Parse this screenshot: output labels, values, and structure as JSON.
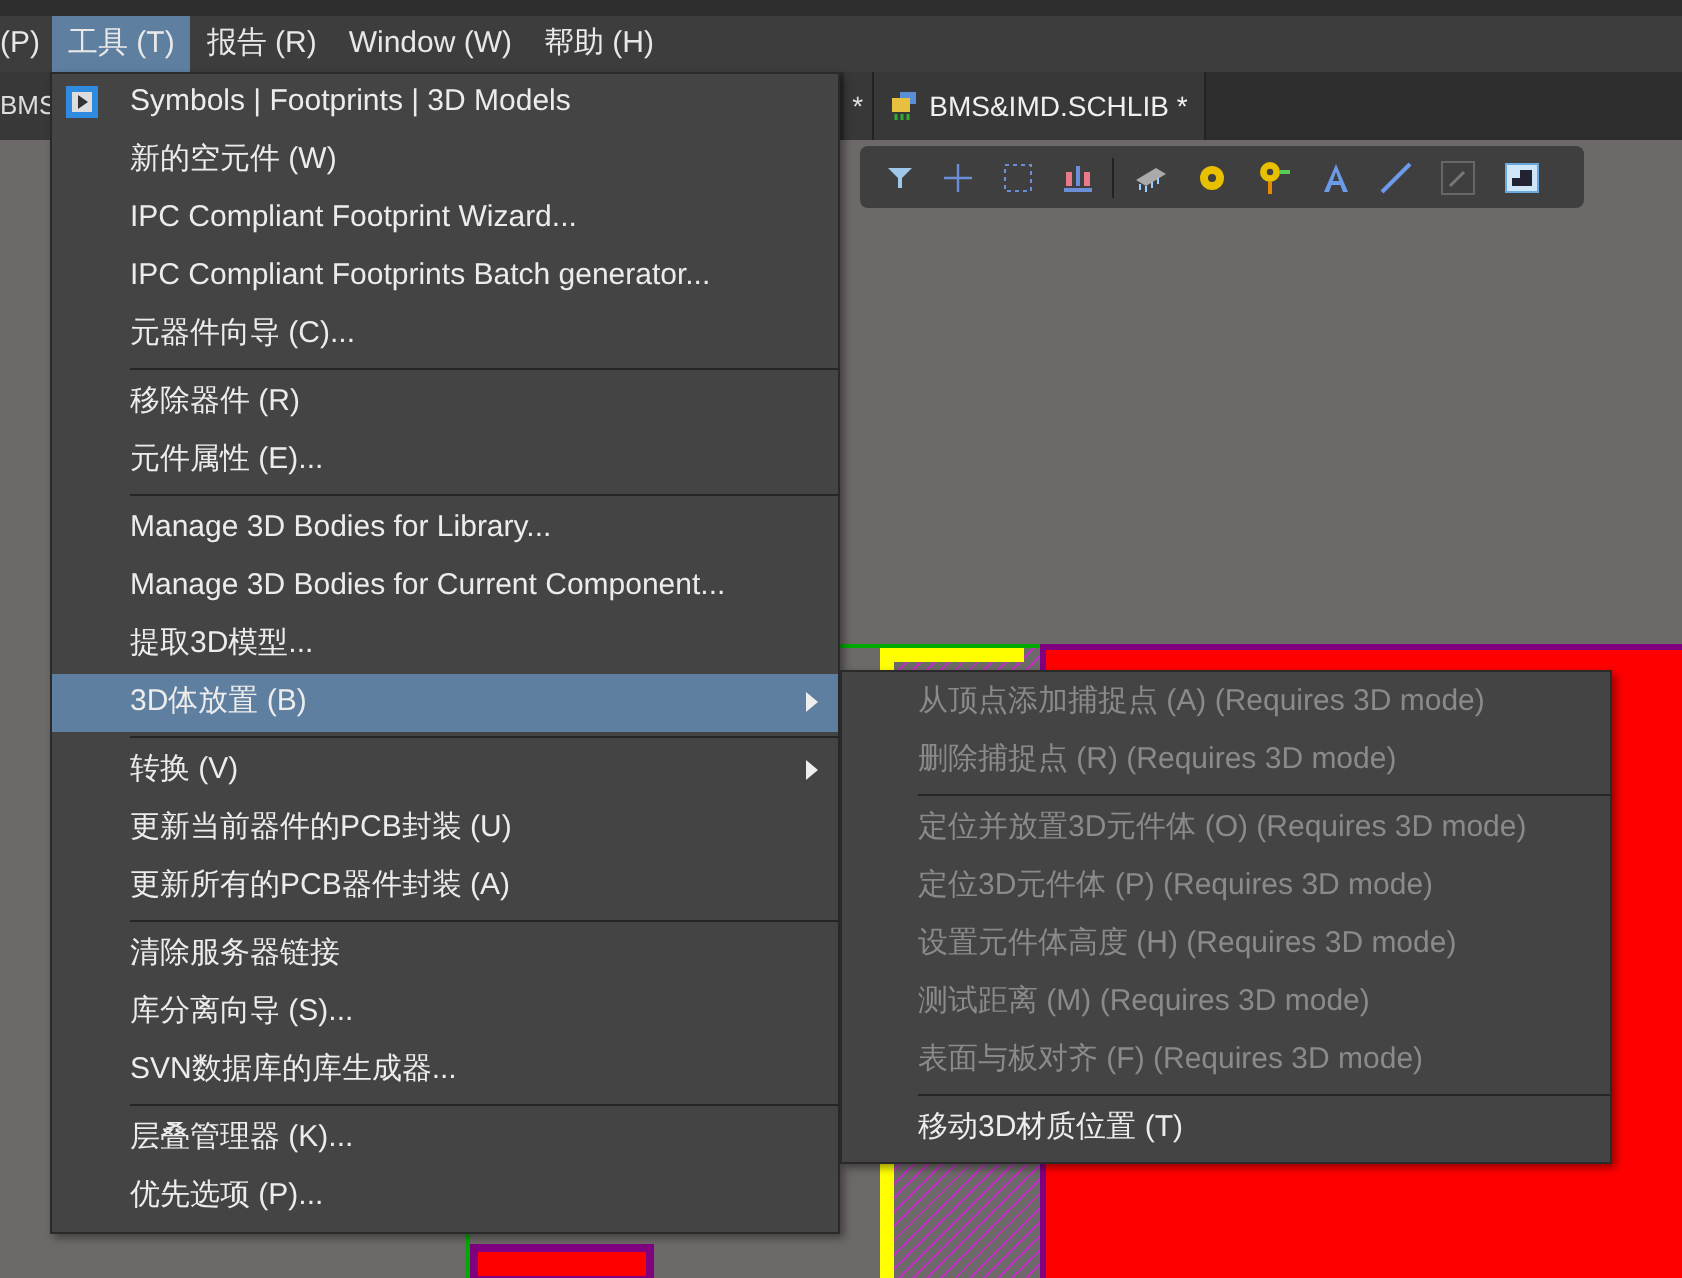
{
  "menubar": [
    {
      "label": "(P)",
      "selected": false
    },
    {
      "label": "工具 (T)",
      "selected": true
    },
    {
      "label": "报告 (R)",
      "selected": false
    },
    {
      "label": "Window (W)",
      "selected": false
    },
    {
      "label": "帮助 (H)",
      "selected": false
    }
  ],
  "tabs": [
    {
      "label": "BMS",
      "selected": false,
      "icon": false
    },
    {
      "label": "*",
      "selected": false,
      "icon": false
    },
    {
      "label": "BMS&IMD.SCHLIB *",
      "selected": true,
      "icon": true
    }
  ],
  "menu": [
    {
      "kind": "item",
      "label": "Symbols | Footprints | 3D Models",
      "icon": true,
      "selected": false,
      "submenu": false
    },
    {
      "kind": "item",
      "label": "新的空元件 (W)",
      "selected": false,
      "submenu": false
    },
    {
      "kind": "item",
      "label": "IPC Compliant Footprint Wizard...",
      "selected": false,
      "submenu": false
    },
    {
      "kind": "item",
      "label": "IPC Compliant Footprints Batch generator...",
      "selected": false,
      "submenu": false
    },
    {
      "kind": "item",
      "label": "元器件向导 (C)...",
      "selected": false,
      "submenu": false
    },
    {
      "kind": "separator"
    },
    {
      "kind": "item",
      "label": "移除器件 (R)",
      "selected": false,
      "submenu": false
    },
    {
      "kind": "item",
      "label": "元件属性 (E)...",
      "selected": false,
      "submenu": false
    },
    {
      "kind": "separator"
    },
    {
      "kind": "item",
      "label": "Manage 3D Bodies for Library...",
      "selected": false,
      "submenu": false
    },
    {
      "kind": "item",
      "label": "Manage 3D Bodies for Current Component...",
      "selected": false,
      "submenu": false
    },
    {
      "kind": "item",
      "label": "提取3D模型...",
      "selected": false,
      "submenu": false
    },
    {
      "kind": "item",
      "label": "3D体放置 (B)",
      "selected": true,
      "submenu": true
    },
    {
      "kind": "separator"
    },
    {
      "kind": "item",
      "label": "转换 (V)",
      "selected": false,
      "submenu": true
    },
    {
      "kind": "item",
      "label": "更新当前器件的PCB封装 (U)",
      "selected": false,
      "submenu": false
    },
    {
      "kind": "item",
      "label": "更新所有的PCB器件封装 (A)",
      "selected": false,
      "submenu": false
    },
    {
      "kind": "separator"
    },
    {
      "kind": "item",
      "label": "清除服务器链接",
      "selected": false,
      "submenu": false
    },
    {
      "kind": "item",
      "label": "库分离向导 (S)...",
      "selected": false,
      "submenu": false
    },
    {
      "kind": "item",
      "label": "SVN数据库的库生成器...",
      "selected": false,
      "submenu": false
    },
    {
      "kind": "separator"
    },
    {
      "kind": "item",
      "label": "层叠管理器 (K)...",
      "selected": false,
      "submenu": false
    },
    {
      "kind": "item",
      "label": "优先选项 (P)...",
      "selected": false,
      "submenu": false
    }
  ],
  "submenu": [
    {
      "kind": "item",
      "label": "从顶点添加捕捉点 (A) (Requires 3D mode)",
      "disabled": true
    },
    {
      "kind": "item",
      "label": "删除捕捉点 (R) (Requires 3D mode)",
      "disabled": true
    },
    {
      "kind": "separator"
    },
    {
      "kind": "item",
      "label": "定位并放置3D元件体 (O) (Requires 3D mode)",
      "disabled": true
    },
    {
      "kind": "item",
      "label": "定位3D元件体 (P) (Requires 3D mode)",
      "disabled": true
    },
    {
      "kind": "item",
      "label": "设置元件体高度 (H) (Requires 3D mode)",
      "disabled": true
    },
    {
      "kind": "item",
      "label": "测试距离 (M) (Requires 3D mode)",
      "disabled": true
    },
    {
      "kind": "item",
      "label": "表面与板对齐 (F) (Requires 3D mode)",
      "disabled": true
    },
    {
      "kind": "separator"
    },
    {
      "kind": "item",
      "label": "移动3D材质位置 (T)",
      "disabled": false
    }
  ]
}
